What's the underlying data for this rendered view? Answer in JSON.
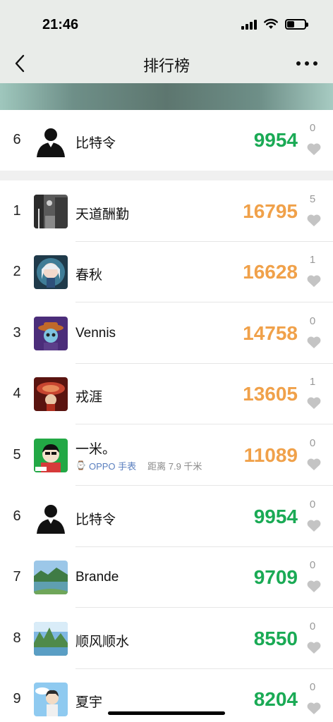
{
  "status": {
    "time": "21:46"
  },
  "nav": {
    "title": "排行榜"
  },
  "colors": {
    "orange": "#f0a14a",
    "green": "#1aaa55"
  },
  "my_entry": {
    "rank": "6",
    "name": "比特令",
    "steps": "9954",
    "likes": "0",
    "color": "green",
    "avatar": "silhouette"
  },
  "ranking": [
    {
      "rank": "1",
      "name": "天道酬勤",
      "steps": "16795",
      "likes": "5",
      "color": "orange",
      "avatar": "street-photo"
    },
    {
      "rank": "2",
      "name": "春秋",
      "steps": "16628",
      "likes": "1",
      "color": "orange",
      "avatar": "anime-girl"
    },
    {
      "rank": "3",
      "name": "Vennis",
      "steps": "14758",
      "likes": "0",
      "color": "orange",
      "avatar": "cartoon-hat"
    },
    {
      "rank": "4",
      "name": "戎涯",
      "steps": "13605",
      "likes": "1",
      "color": "orange",
      "avatar": "red-art"
    },
    {
      "rank": "5",
      "name": "一米。",
      "steps": "11089",
      "likes": "0",
      "color": "orange",
      "avatar": "green-cartoon",
      "device": "OPPO 手表",
      "distance": "距离 7.9 千米"
    },
    {
      "rank": "6",
      "name": "比特令",
      "steps": "9954",
      "likes": "0",
      "color": "green",
      "avatar": "silhouette"
    },
    {
      "rank": "7",
      "name": "Brande",
      "steps": "9709",
      "likes": "0",
      "color": "green",
      "avatar": "landscape-lake"
    },
    {
      "rank": "8",
      "name": "顺风顺水",
      "steps": "8550",
      "likes": "0",
      "color": "green",
      "avatar": "landscape-mountain"
    },
    {
      "rank": "9",
      "name": "夏宇",
      "steps": "8204",
      "likes": "0",
      "color": "green",
      "avatar": "boy-illustration"
    }
  ]
}
